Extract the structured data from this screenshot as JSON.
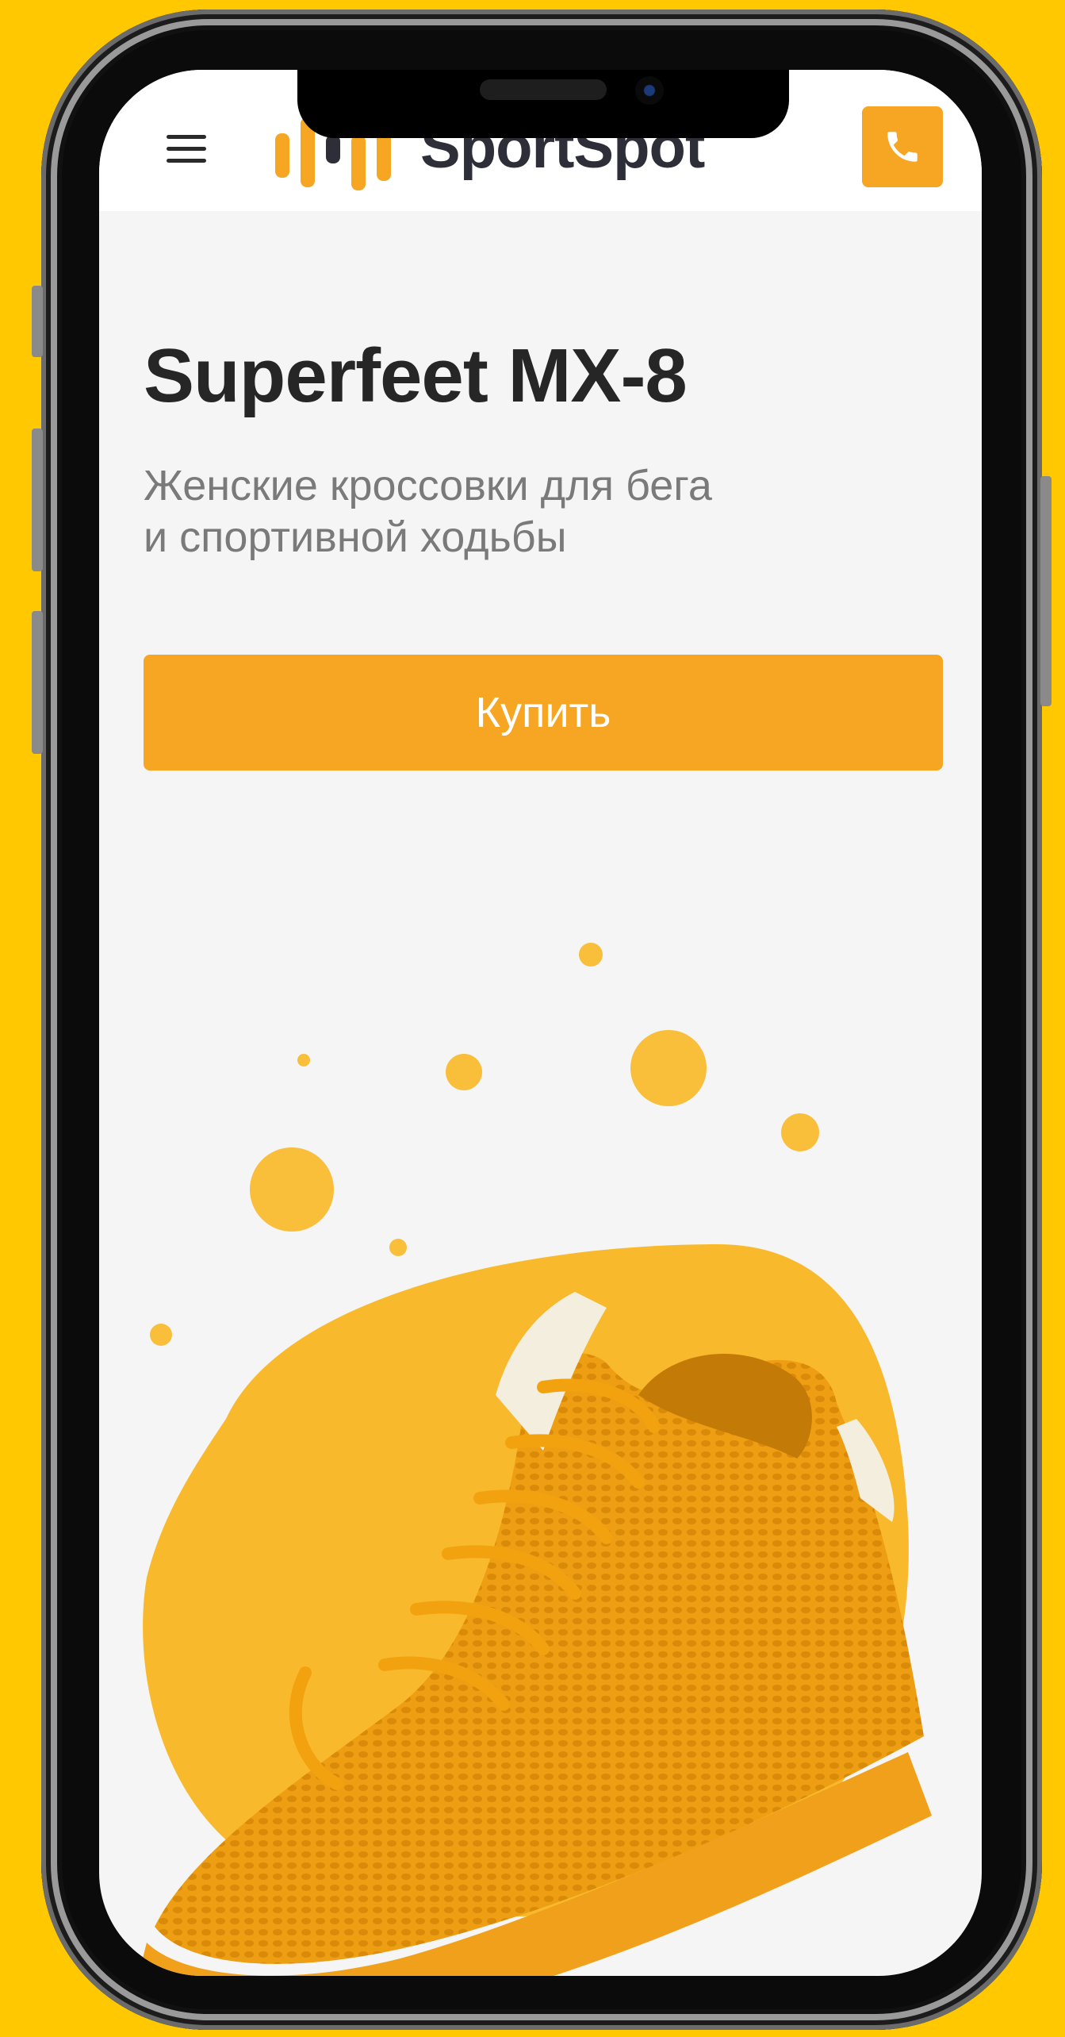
{
  "header": {
    "logo_text": "SportSpot",
    "menu_icon": "hamburger-menu-icon",
    "call_icon": "phone-icon"
  },
  "product": {
    "title": "Superfeet MX-8",
    "subtitle_line1": "Женские кроссовки для бега",
    "subtitle_line2": "и спортивной ходьбы",
    "buy_label": "Купить"
  },
  "colors": {
    "background": "#FFC800",
    "accent": "#F6A623",
    "screen_bg": "#F5F5F5",
    "title": "#262626",
    "subtitle": "#7a7a7a"
  }
}
